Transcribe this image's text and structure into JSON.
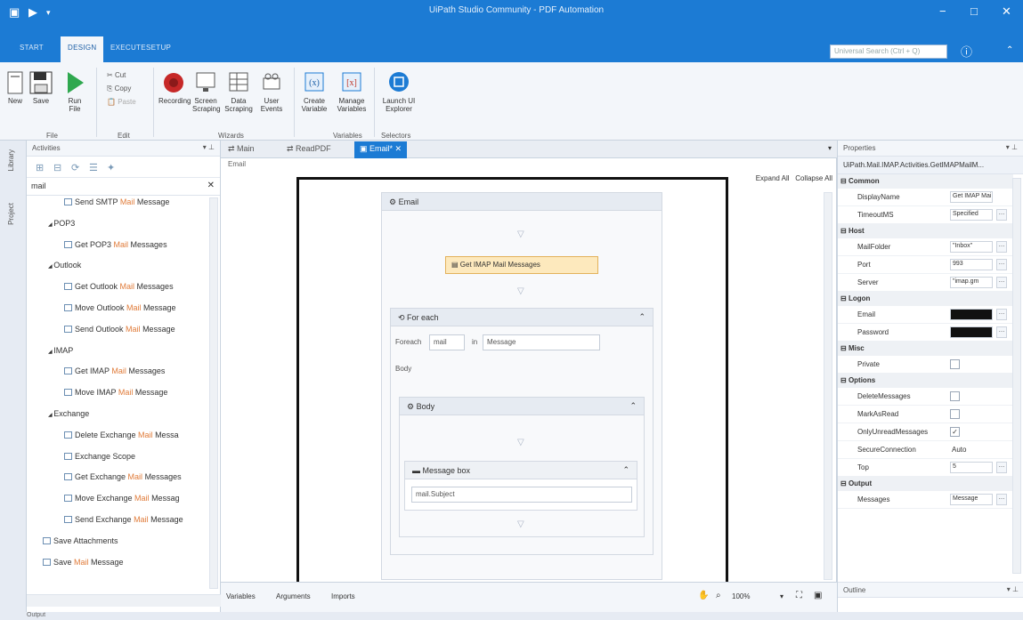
{
  "window": {
    "title": "UiPath Studio Community - PDF Automation",
    "controls": [
      "−",
      "□",
      "✕"
    ]
  },
  "ribbon_tabs": [
    "START",
    "DESIGN",
    "EXECUTE",
    "SETUP"
  ],
  "search": {
    "placeholder": "Universal Search (Ctrl + Q)"
  },
  "ribbon": {
    "file": {
      "new": "New",
      "save": "Save",
      "run_line1": "Run",
      "run_line2": "File",
      "group": "File"
    },
    "edit": {
      "cut": "Cut",
      "copy": "Copy",
      "paste": "Paste",
      "group": "Edit"
    },
    "wizards": {
      "recording": "Recording",
      "screen_scraping": "Screen Scraping",
      "data_scraping": "Data Scraping",
      "user_events": "User Events",
      "group": "Wizards"
    },
    "variables": {
      "create": "Create Variable",
      "manage": "Manage Variables",
      "group": "Variables"
    },
    "selectors": {
      "explorer": "Launch UI Explorer",
      "group": "Selectors"
    }
  },
  "left_strip": {
    "library": "Library",
    "project": "Project"
  },
  "activities": {
    "title": "Activities",
    "search_value": "mail",
    "items": [
      {
        "label_pre": "Send SMTP ",
        "label_hl": "Mail",
        "label_post": " Message",
        "level": 2
      },
      {
        "label_pre": "POP3",
        "label_hl": "",
        "label_post": "",
        "level": 1
      },
      {
        "label_pre": "Get POP3 ",
        "label_hl": "Mail",
        "label_post": " Messages",
        "level": 2
      },
      {
        "label_pre": "Outlook",
        "label_hl": "",
        "label_post": "",
        "level": 1
      },
      {
        "label_pre": "Get Outlook ",
        "label_hl": "Mail",
        "label_post": " Messages",
        "level": 2
      },
      {
        "label_pre": "Move Outlook ",
        "label_hl": "Mail",
        "label_post": " Message",
        "level": 2
      },
      {
        "label_pre": "Send Outlook ",
        "label_hl": "Mail",
        "label_post": " Message",
        "level": 2
      },
      {
        "label_pre": "IMAP",
        "label_hl": "",
        "label_post": "",
        "level": 1
      },
      {
        "label_pre": "Get IMAP ",
        "label_hl": "Mail",
        "label_post": " Messages",
        "level": 2
      },
      {
        "label_pre": "Move IMAP ",
        "label_hl": "Mail",
        "label_post": " Message",
        "level": 2
      },
      {
        "label_pre": "Exchange",
        "label_hl": "",
        "label_post": "",
        "level": 1
      },
      {
        "label_pre": "Delete Exchange ",
        "label_hl": "Mail",
        "label_post": " Messa",
        "level": 2
      },
      {
        "label_pre": "Exchange Scope",
        "label_hl": "",
        "label_post": "",
        "level": 2
      },
      {
        "label_pre": "Get Exchange ",
        "label_hl": "Mail",
        "label_post": " Messages",
        "level": 2
      },
      {
        "label_pre": "Move Exchange ",
        "label_hl": "Mail",
        "label_post": " Messag",
        "level": 2
      },
      {
        "label_pre": "Send Exchange ",
        "label_hl": "Mail",
        "label_post": " Message",
        "level": 2
      },
      {
        "label_pre": "Save Attachments",
        "label_hl": "",
        "label_post": "",
        "level": 0
      },
      {
        "label_pre": "Save ",
        "label_hl": "Mail",
        "label_post": " Message",
        "level": 0
      }
    ]
  },
  "doc_tabs": [
    "Main",
    "ReadPDF",
    "Email*"
  ],
  "designer": {
    "breadcrumb": "Email",
    "expand_all": "Expand All",
    "collapse_all": "Collapse All",
    "seq_title": "Email",
    "get_imap": "Get IMAP Mail Messages",
    "foreach_title": "For each",
    "foreach_label": "Foreach",
    "foreach_var": "mail",
    "foreach_in": "in",
    "foreach_collection": "Message",
    "body_label": "Body",
    "body_seq": "Body",
    "msgbox_title": "Message box",
    "msgbox_value": "mail.Subject"
  },
  "statusbar": {
    "variables": "Variables",
    "arguments": "Arguments",
    "imports": "Imports",
    "zoom": "100%"
  },
  "properties": {
    "title": "Properties",
    "type_name": "UiPath.Mail.IMAP.Activities.GetIMAPMailM...",
    "outline": "Outline",
    "categories": [
      {
        "name": "Common",
        "rows": [
          {
            "name": "DisplayName",
            "value": "Get IMAP Mai",
            "kind": "text"
          },
          {
            "name": "TimeoutMS",
            "value": "Specified",
            "kind": "text",
            "btn": true
          }
        ]
      },
      {
        "name": "Host",
        "rows": [
          {
            "name": "MailFolder",
            "value": "\"Inbox\"",
            "kind": "text",
            "btn": true
          },
          {
            "name": "Port",
            "value": "993",
            "kind": "text",
            "btn": true
          },
          {
            "name": "Server",
            "value": "\"imap.gm",
            "kind": "text",
            "btn": true
          }
        ]
      },
      {
        "name": "Logon",
        "rows": [
          {
            "name": "Email",
            "value": "\"",
            "kind": "redact",
            "btn": true
          },
          {
            "name": "Password",
            "value": "\"",
            "kind": "redact",
            "btn": true
          }
        ]
      },
      {
        "name": "Misc",
        "rows": [
          {
            "name": "Private",
            "value": "",
            "kind": "check"
          }
        ]
      },
      {
        "name": "Options",
        "rows": [
          {
            "name": "DeleteMessages",
            "value": "",
            "kind": "check"
          },
          {
            "name": "MarkAsRead",
            "value": "",
            "kind": "check"
          },
          {
            "name": "OnlyUnreadMessages",
            "value": "✓",
            "kind": "check"
          },
          {
            "name": "SecureConnection",
            "value": "Auto",
            "kind": "plain"
          },
          {
            "name": "Top",
            "value": "5",
            "kind": "text",
            "btn": true
          }
        ]
      },
      {
        "name": "Output",
        "rows": [
          {
            "name": "Messages",
            "value": "Message",
            "kind": "text",
            "btn": true
          }
        ]
      }
    ]
  },
  "bottom": {
    "output": "Output"
  }
}
